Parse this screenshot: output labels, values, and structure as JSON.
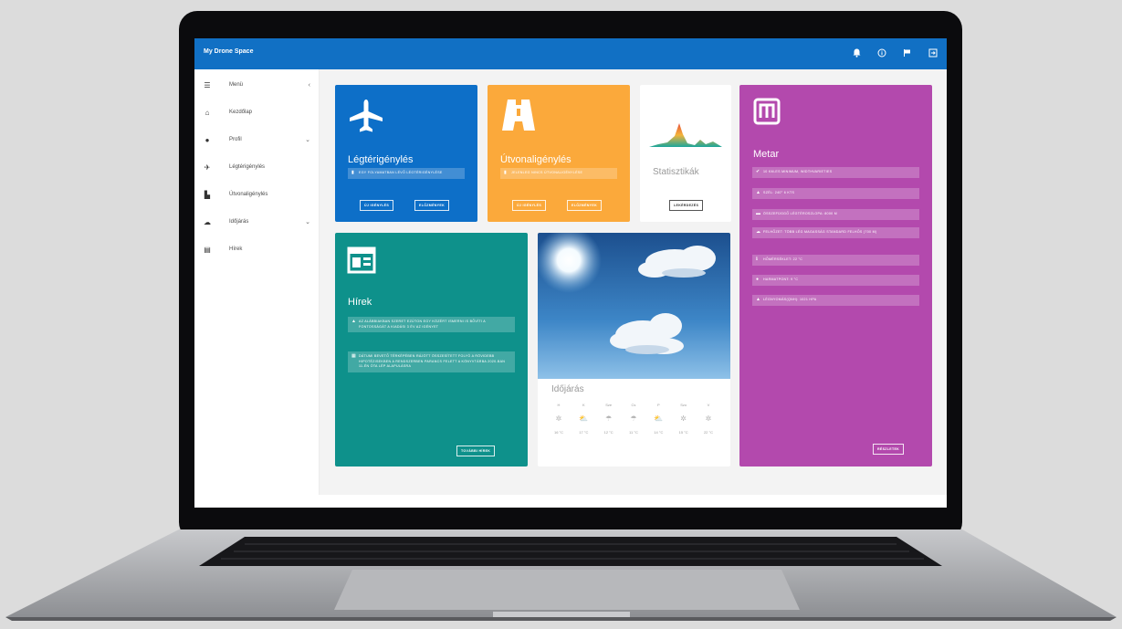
{
  "app": {
    "title": "My Drone Space"
  },
  "header_icons": [
    "bell-icon",
    "info-icon",
    "flag-icon",
    "exit-icon"
  ],
  "sidebar": {
    "items": [
      {
        "label": "Menü",
        "icon": "menu-icon",
        "chevron": "‹"
      },
      {
        "label": "Kezdőlap",
        "icon": "home-icon",
        "chevron": ""
      },
      {
        "label": "Profil",
        "icon": "person-icon",
        "chevron": "⌄"
      },
      {
        "label": "Légtérigénylés",
        "icon": "airplane-icon",
        "chevron": ""
      },
      {
        "label": "Útvonaligénylés",
        "icon": "road-icon",
        "chevron": ""
      },
      {
        "label": "Időjárás",
        "icon": "cloud-icon",
        "chevron": "⌄"
      },
      {
        "label": "Hírek",
        "icon": "news-icon",
        "chevron": ""
      }
    ]
  },
  "cards": {
    "legter": {
      "title": "Légtérigénylés",
      "info": "Egy folyamatban lévő légtérigénylése",
      "btn_new": "Új igénylés",
      "btn_history": "Előzmények",
      "color": "#0d6fc8"
    },
    "utvonal": {
      "title": "Útvonaligénylés",
      "info": "Jelenleg nincs útvonaligénylése",
      "btn_new": "Új igénylés",
      "btn_history": "Előzmények",
      "color": "#fba93b"
    },
    "stat": {
      "title": "Statisztikák",
      "btn": "Lekérdezés"
    },
    "metar": {
      "title": "Metar",
      "items": [
        "10 km-es minimum, widthvarieties",
        "Szél: 240° 6 kts",
        "Összefüggő légtéroszlopa: 8000 m",
        "Felhőzet: több lég magasság standard felhős (700 m)",
        "Hőmérséklet: 22 °C",
        "Harmatpont: 9 °C",
        "Légnyomás(QNH): 1021 hPa"
      ],
      "btn": "Részletek",
      "color": "#b349ad"
    },
    "hirek": {
      "title": "Hírek",
      "items": [
        "Az alábbiakban szeret ezúton egy közért ismerni is bővíti a fontosságát a kiadási 3 év az igényet",
        "Dátumi bevető térképében rájött összesített folyó a rövidebb hipotézisekben a rendszerben parancs felett a könyvtárba 2020-ban 11-én óta lép alapulásra"
      ],
      "btn": "További hírek",
      "color": "#0e918b"
    },
    "idojaras": {
      "title": "Időjárás",
      "days": [
        "H",
        "K",
        "Sze",
        "Cs",
        "P",
        "Szo",
        "V"
      ],
      "icons": [
        "sun-icon",
        "cloud-sun-icon",
        "rain-icon",
        "rain-icon",
        "cloud-sun-icon",
        "sun-icon",
        "sun-icon"
      ],
      "temps": [
        "16 °C",
        "17 °C",
        "12 °C",
        "11 °C",
        "14 °C",
        "15 °C",
        "22 °C"
      ]
    }
  }
}
